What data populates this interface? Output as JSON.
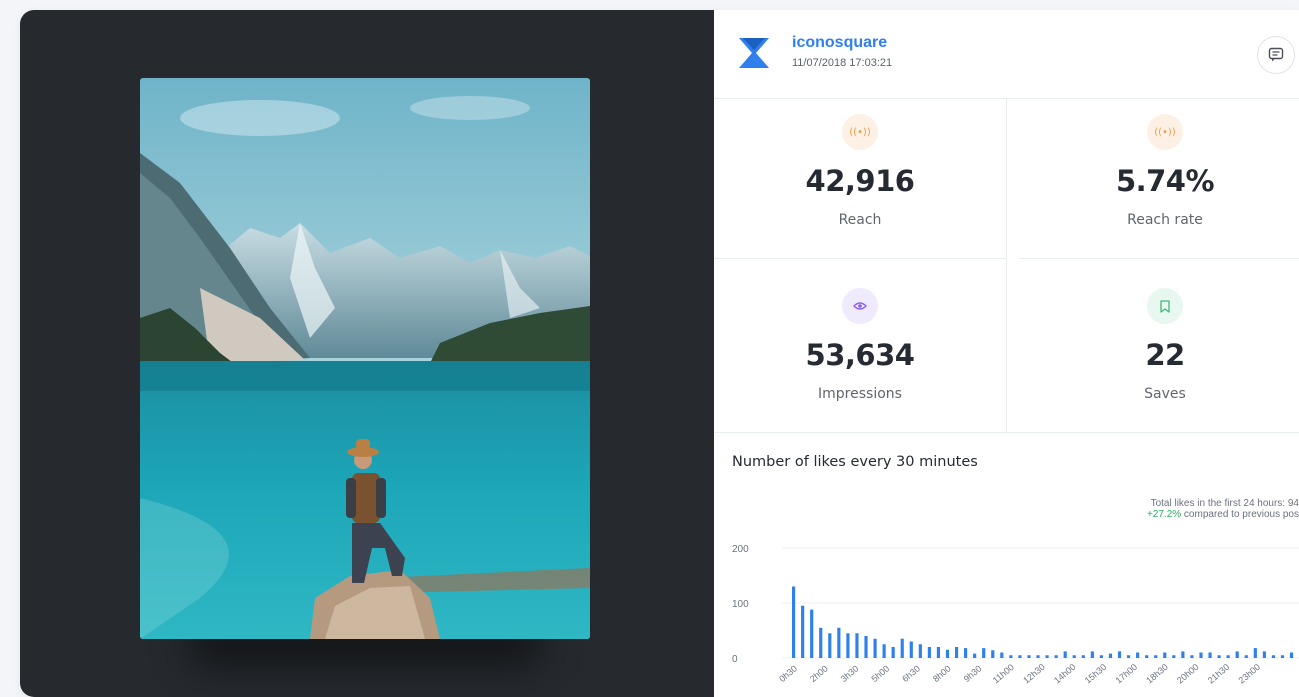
{
  "account": {
    "name": "iconosquare",
    "date": "11/07/2018 17:03:21"
  },
  "metrics": [
    {
      "id": "reach",
      "value": "42,916",
      "label": "Reach",
      "icon": "broadcast-icon",
      "color": "#f2994a",
      "bg": "#fdf1e6"
    },
    {
      "id": "reach-rate",
      "value": "5.74%",
      "label": "Reach rate",
      "icon": "broadcast-icon",
      "color": "#f2994a",
      "bg": "#fdf1e6"
    },
    {
      "id": "impressions",
      "value": "53,634",
      "label": "Impressions",
      "icon": "eye-icon",
      "color": "#8b5cf6",
      "bg": "#efeafc"
    },
    {
      "id": "saves",
      "value": "22",
      "label": "Saves",
      "icon": "bookmark-icon",
      "color": "#3fb879",
      "bg": "#e8f7ef"
    }
  ],
  "likes_chart": {
    "title": "Number of likes every 30 minutes",
    "summary_total": "Total likes in the first 24 hours: 94",
    "summary_change_value": "+27.2%",
    "summary_change_text": " compared to previous pos"
  },
  "chart_data": {
    "type": "bar",
    "title": "Number of likes every 30 minutes",
    "ylim": [
      0,
      200
    ],
    "yticks": [
      0,
      100,
      200
    ],
    "xtick_labels": [
      "0h30",
      "2h00",
      "3h30",
      "5h00",
      "6h30",
      "8h00",
      "9h30",
      "11h00",
      "12h30",
      "14h00",
      "15h30",
      "17h00",
      "18h30",
      "20h00",
      "21h30",
      "23h00"
    ],
    "bar_color": "#2f80ed",
    "values": [
      130,
      95,
      88,
      55,
      45,
      55,
      45,
      45,
      40,
      35,
      25,
      20,
      35,
      30,
      25,
      20,
      20,
      15,
      20,
      18,
      8,
      18,
      14,
      10,
      5,
      5,
      5,
      5,
      5,
      5,
      12,
      5,
      5,
      12,
      5,
      8,
      12,
      5,
      10,
      5,
      5,
      10,
      5,
      12,
      5,
      10,
      10,
      5,
      5,
      12,
      5,
      18,
      12,
      5,
      5,
      10
    ]
  }
}
